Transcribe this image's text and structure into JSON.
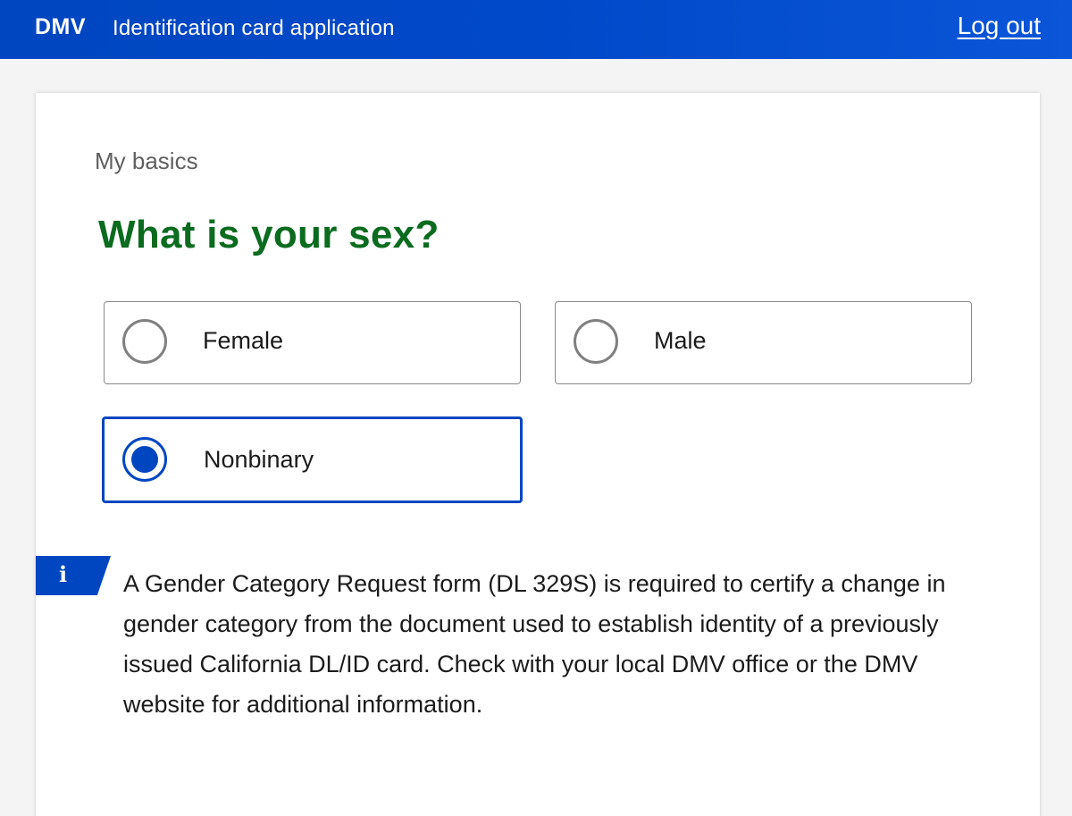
{
  "header": {
    "brand": "DMV",
    "title": "Identification card application",
    "logout_label": "Log out",
    "background_color": "#0046c0"
  },
  "form": {
    "section_label": "My basics",
    "question": "What is your sex?",
    "question_color": "#0b6b1f",
    "options": [
      {
        "label": "Female",
        "selected": false
      },
      {
        "label": "Male",
        "selected": false
      },
      {
        "label": "Nonbinary",
        "selected": true
      }
    ],
    "selected_value": "Nonbinary"
  },
  "notice": {
    "icon": "info-icon",
    "icon_glyph": "i",
    "text": "A Gender Category Request form (DL 329S) is required to certify a change in gender category from the document used to establish identity of a previously issued California DL/ID card. Check with your local DMV office or the DMV website for additional information."
  }
}
